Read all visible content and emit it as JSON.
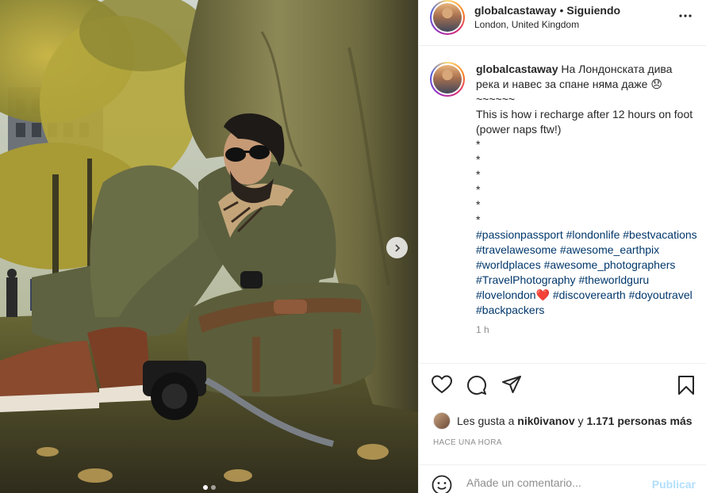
{
  "post": {
    "username": "globalcastaway",
    "separator": "•",
    "follow_status": "Siguiendo",
    "location": "London, United Kingdom"
  },
  "caption": {
    "username": "globalcastaway",
    "text": "На Лондонската дива река и навес за спане няма даже 😞\n~~~~~~\nThis is how i recharge after 12 hours on foot (power naps ftw!)\n*\n*\n*\n*\n*\n*",
    "hashtags": [
      "#passionpassport",
      "#londonlife",
      "#bestvacations",
      "#travelawesome",
      "#awesome_earthpix",
      "#worldplaces",
      "#awesome_photographers",
      "#TravelPhotography",
      "#theworldguru",
      "#lovelondon❤️",
      "#discoverearth",
      "#doyoutravel",
      "#backpackers"
    ],
    "time": "1 h"
  },
  "likes": {
    "prefix": "Les gusta a",
    "user": "nik0ivanov",
    "middle": "y",
    "count": "1.171 personas más"
  },
  "timestamp": "HACE UNA HORA",
  "comment_box": {
    "placeholder": "Añade un comentario...",
    "publish_label": "Publicar"
  },
  "icons": {
    "more": "more-options-icon",
    "like": "heart-icon",
    "comment": "comment-bubble-icon",
    "share": "paper-plane-icon",
    "save": "bookmark-icon",
    "emoji": "smiley-icon",
    "next": "chevron-right-icon"
  },
  "colors": {
    "link": "#00376b",
    "muted": "#8e8e8e",
    "publish_disabled": "#b2dffc",
    "heart": "#e0245e"
  }
}
